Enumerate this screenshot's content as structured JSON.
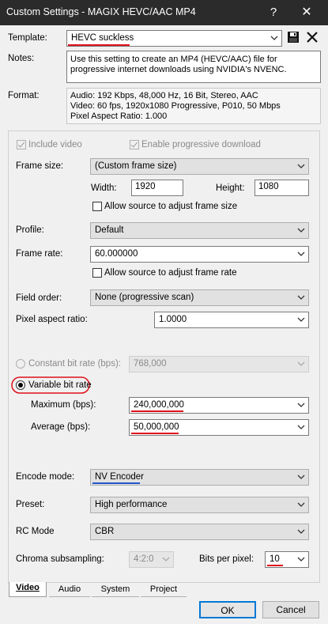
{
  "window": {
    "title": "Custom Settings - MAGIX HEVC/AAC MP4",
    "help_glyph": "?",
    "close_glyph": "✕"
  },
  "template": {
    "label": "Template:",
    "value": "HEVC suckless"
  },
  "notes": {
    "label": "Notes:",
    "text": "Use this setting to create an MP4 (HEVC/AAC) file for progressive internet downloads using NVIDIA's NVENC."
  },
  "format": {
    "label": "Format:",
    "lines": [
      "Audio: 192 Kbps, 48,000 Hz, 16 Bit, Stereo, AAC",
      "Video: 60 fps, 1920x1080 Progressive, P010, 50 Mbps",
      "Pixel Aspect Ratio: 1.000"
    ]
  },
  "video": {
    "include_video": "Include video",
    "progressive_download": "Enable progressive download",
    "frame_size": {
      "label": "Frame size:",
      "value": "(Custom frame size)"
    },
    "width": {
      "label": "Width:",
      "value": "1920"
    },
    "height": {
      "label": "Height:",
      "value": "1080"
    },
    "allow_frame_size": "Allow source to adjust frame size",
    "profile": {
      "label": "Profile:",
      "value": "Default"
    },
    "frame_rate": {
      "label": "Frame rate:",
      "value": "60.000000"
    },
    "allow_frame_rate": "Allow source to adjust frame rate",
    "field_order": {
      "label": "Field order:",
      "value": "None (progressive scan)"
    },
    "pixel_aspect": {
      "label": "Pixel aspect ratio:",
      "value": "1.0000"
    },
    "cbr": {
      "label": "Constant bit rate (bps):",
      "value": "768,000"
    },
    "vbr": {
      "label": "Variable bit rate"
    },
    "maximum": {
      "label": "Maximum (bps):",
      "value": "240,000,000"
    },
    "average": {
      "label": "Average (bps):",
      "value": "50,000,000"
    },
    "encode_mode": {
      "label": "Encode mode:",
      "value": "NV Encoder"
    },
    "preset": {
      "label": "Preset:",
      "value": "High performance"
    },
    "rc_mode": {
      "label": "RC Mode",
      "value": "CBR"
    },
    "chroma": {
      "label": "Chroma subsampling:",
      "value": "4:2:0"
    },
    "bits_per_pixel": {
      "label": "Bits per pixel:",
      "value": "10"
    }
  },
  "tabs": [
    "Video",
    "Audio",
    "System",
    "Project"
  ],
  "buttons": {
    "ok": "OK",
    "cancel": "Cancel"
  },
  "colors": {
    "titlebar": "#2b2b2b",
    "annotation_red": "#e0101a",
    "annotation_blue": "#2255cc"
  }
}
